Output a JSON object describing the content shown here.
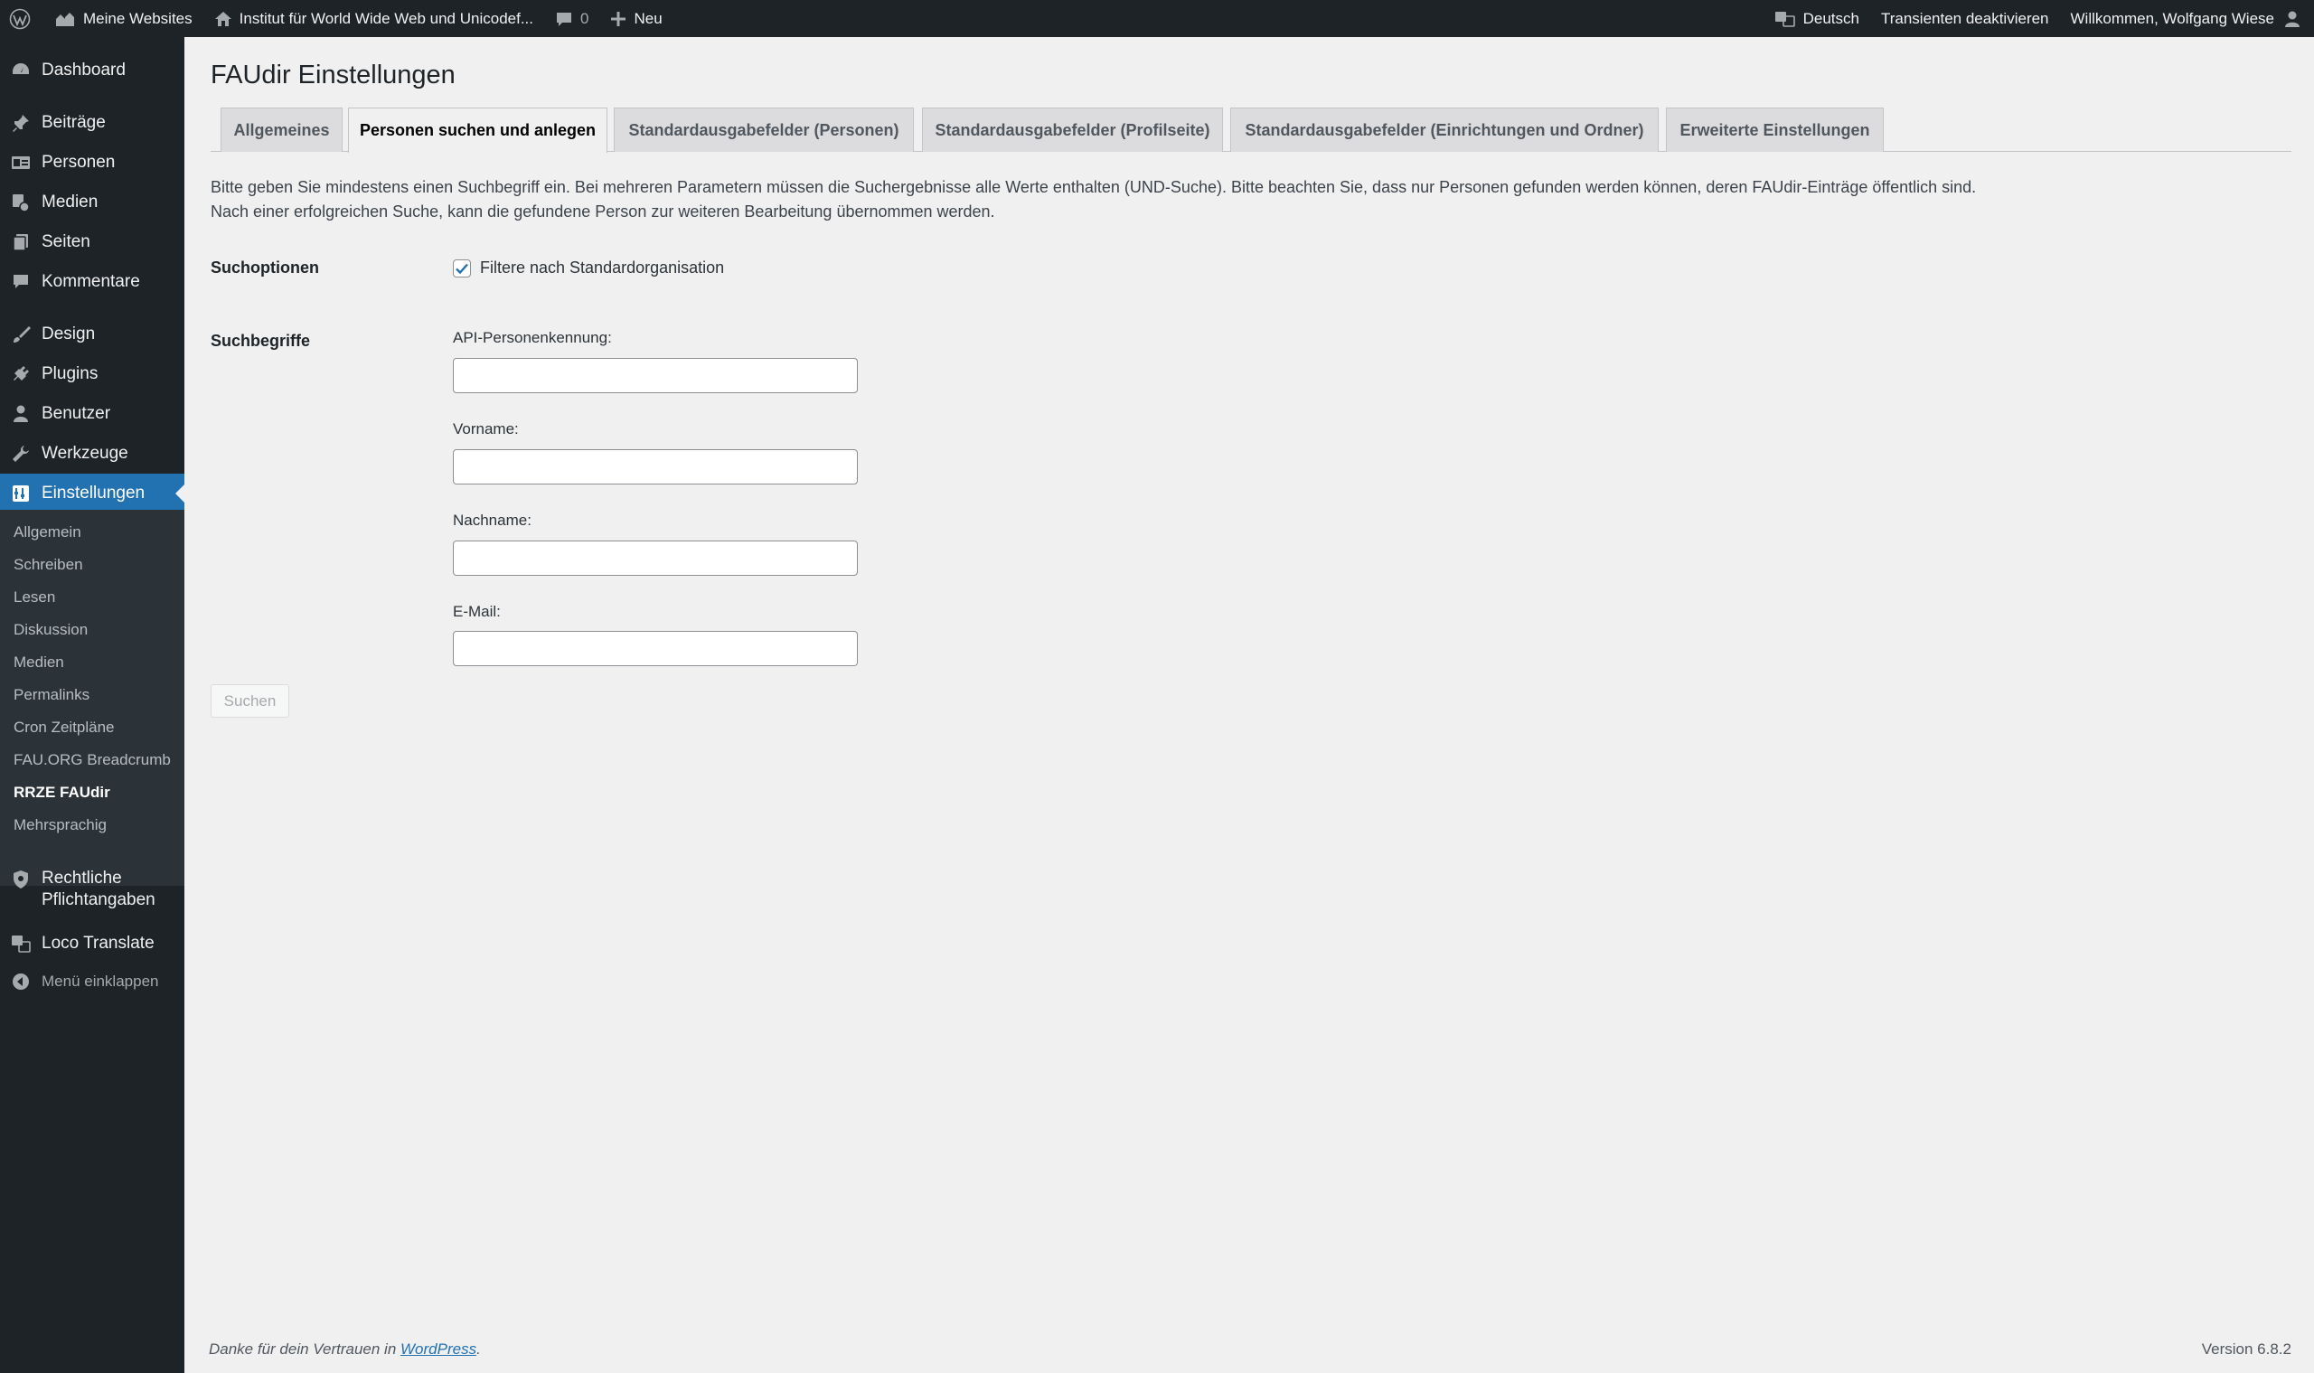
{
  "adminbar": {
    "my_sites": "Meine Websites",
    "site_name": "Institut für World Wide Web und Unicodef...",
    "comments_count": "0",
    "new_label": "Neu",
    "language": "Deutsch",
    "transients": "Transienten deaktivieren",
    "greeting": "Willkommen, Wolfgang Wiese"
  },
  "sidebar": {
    "items": [
      {
        "label": "Dashboard",
        "icon": "dashboard-icon"
      },
      {
        "label": "Beiträge",
        "icon": "pin-icon"
      },
      {
        "label": "Personen",
        "icon": "id-card-icon"
      },
      {
        "label": "Medien",
        "icon": "media-icon"
      },
      {
        "label": "Seiten",
        "icon": "pages-icon"
      },
      {
        "label": "Kommentare",
        "icon": "comment-icon"
      },
      {
        "label": "Design",
        "icon": "brush-icon"
      },
      {
        "label": "Plugins",
        "icon": "plug-icon"
      },
      {
        "label": "Benutzer",
        "icon": "user-icon"
      },
      {
        "label": "Werkzeuge",
        "icon": "wrench-icon"
      },
      {
        "label": "Einstellungen",
        "icon": "settings-icon"
      }
    ],
    "submenu": [
      "Allgemein",
      "Schreiben",
      "Lesen",
      "Diskussion",
      "Medien",
      "Permalinks",
      "Cron Zeitpläne",
      "FAU.ORG Breadcrumb",
      "RRZE FAUdir",
      "Mehrsprachig"
    ],
    "current_submenu": "RRZE FAUdir",
    "extra": [
      {
        "label": "Rechtliche Pflichtangaben",
        "icon": "shield-icon"
      },
      {
        "label": "Loco Translate",
        "icon": "translate-icon"
      }
    ],
    "collapse_label": "Menü einklappen"
  },
  "page": {
    "title": "FAUdir Einstellungen",
    "tabs": [
      {
        "label": "Allgemeines"
      },
      {
        "label": "Personen suchen und anlegen",
        "active": true
      },
      {
        "label": "Standardausgabefelder (Personen)"
      },
      {
        "label": "Standardausgabefelder (Profilseite)"
      },
      {
        "label": "Standardausgabefelder (Einrichtungen und Ordner)"
      },
      {
        "label": "Erweiterte Einstellungen"
      }
    ],
    "intro_line1": "Bitte geben Sie mindestens einen Suchbegriff ein. Bei mehreren Parametern müssen die Suchergebnisse alle Werte enthalten (UND-Suche). Bitte beachten Sie, dass nur Personen gefunden werden können, deren FAUdir-Einträge öffentlich sind.",
    "intro_line2": "Nach einer erfolgreichen Suche, kann die gefundene Person zur weiteren Bearbeitung übernommen werden.",
    "search_options_label": "Suchoptionen",
    "filter_checkbox_label": "Filtere nach Standardorganisation",
    "filter_checked": true,
    "search_terms_label": "Suchbegriffe",
    "fields": [
      {
        "label": "API-Personenkennung:",
        "value": ""
      },
      {
        "label": "Vorname:",
        "value": ""
      },
      {
        "label": "Nachname:",
        "value": ""
      },
      {
        "label": "E-Mail:",
        "value": ""
      }
    ],
    "search_button": "Suchen"
  },
  "footer": {
    "thanks_prefix": "Danke für dein Vertrauen in ",
    "wordpress_link": "WordPress",
    "thanks_suffix": ".",
    "version": "Version 6.8.2"
  },
  "colors": {
    "accent": "#2271b1",
    "sidebar_bg": "#1d2327",
    "submenu_bg": "#2c3338",
    "page_bg": "#f0f0f1"
  }
}
